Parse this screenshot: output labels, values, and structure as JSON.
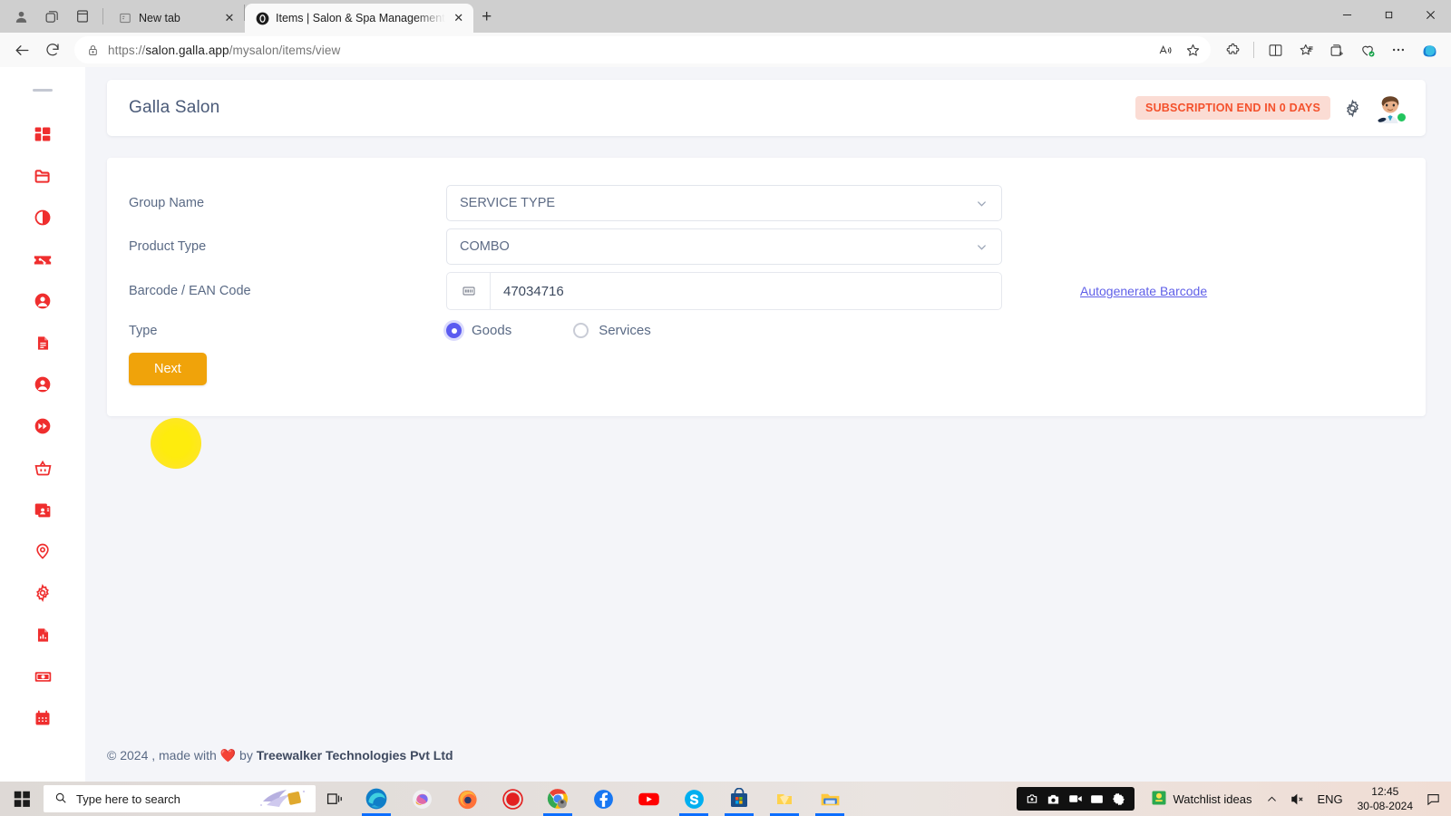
{
  "browser": {
    "tabs": [
      {
        "title": "New tab",
        "active": false,
        "favicon": "newtab-icon"
      },
      {
        "title": "Items | Salon & Spa Management",
        "active": true,
        "favicon": "site-favicon"
      }
    ],
    "newtab_label": "+",
    "close_label": "✕",
    "toolbar_icons": [
      "profile-icon",
      "workspaces-icon",
      "tab-actions-icon"
    ],
    "window_controls": {
      "minimize": "—",
      "maximize": "❐",
      "close": "✕"
    },
    "address": {
      "url_prefix": "https://",
      "url_host": "salon.galla.app",
      "url_path": "/mysalon/items/view",
      "full_url": "https://salon.galla.app/mysalon/items/view",
      "lock_icon": "lock-icon"
    },
    "nav": {
      "back": "back-arrow-icon",
      "refresh": "refresh-icon"
    },
    "omnibox_actions": [
      "read-aloud-icon",
      "favorite-star-icon"
    ],
    "toolbar_right": [
      "extensions-icon",
      "split-screen-icon",
      "collections-icon",
      "add-collection-icon",
      "browser-essentials-icon",
      "settings-more-icon",
      "copilot-icon"
    ]
  },
  "sidebar": {
    "collapse_handle": "collapse-handle",
    "items": [
      {
        "icon": "dashboard-grid-icon",
        "name": "dashboard"
      },
      {
        "icon": "folder-icon",
        "name": "catalog"
      },
      {
        "icon": "contrast-circle-icon",
        "name": "appearance"
      },
      {
        "icon": "discount-tag-icon",
        "name": "offers"
      },
      {
        "icon": "user-circle-icon",
        "name": "customers"
      },
      {
        "icon": "document-icon",
        "name": "invoices"
      },
      {
        "icon": "user-circle-icon",
        "name": "staff"
      },
      {
        "icon": "fast-forward-icon",
        "name": "quick-actions"
      },
      {
        "icon": "basket-icon",
        "name": "orders"
      },
      {
        "icon": "id-card-icon",
        "name": "memberships"
      },
      {
        "icon": "location-pin-icon",
        "name": "branches"
      },
      {
        "icon": "gear-icon",
        "name": "settings"
      },
      {
        "icon": "report-chart-icon",
        "name": "reports"
      },
      {
        "icon": "money-icon",
        "name": "payments"
      },
      {
        "icon": "calendar-icon",
        "name": "appointments"
      }
    ]
  },
  "header": {
    "brand": "Galla Salon",
    "subscription_badge": "SUBSCRIPTION END IN 0 DAYS",
    "gear_icon": "gear-icon",
    "avatar": "user-avatar",
    "status": "online"
  },
  "form": {
    "fields": [
      {
        "label": "Group Name",
        "value": "SERVICE TYPE",
        "type": "select"
      },
      {
        "label": "Product Type",
        "value": "COMBO",
        "type": "select"
      }
    ],
    "barcode": {
      "label": "Barcode / EAN Code",
      "value": "47034716",
      "addon_icon": "barcode-icon",
      "link": "Autogenerate Barcode"
    },
    "type": {
      "label": "Type",
      "options": [
        {
          "label": "Goods",
          "selected": true
        },
        {
          "label": "Services",
          "selected": false
        }
      ]
    },
    "next_button": "Next"
  },
  "footer": {
    "copyright": "© 2024 , made with",
    "heart": "❤️",
    "by": "by",
    "company": "Treewalker Technologies Pvt Ltd"
  },
  "taskbar": {
    "start_icon": "windows-start-icon",
    "search_placeholder": "Type here to search",
    "search_icon": "search-icon",
    "taskview_icon": "task-view-icon",
    "apps": [
      {
        "name": "edge-icon",
        "running": true
      },
      {
        "name": "copilot-icon",
        "running": false
      },
      {
        "name": "firefox-icon",
        "running": false
      },
      {
        "name": "record-icon",
        "running": false
      },
      {
        "name": "chrome-icon",
        "running": true
      },
      {
        "name": "facebook-icon",
        "running": false
      },
      {
        "name": "youtube-icon",
        "running": false
      },
      {
        "name": "skype-icon",
        "running": true
      },
      {
        "name": "microsoft-store-icon",
        "running": true
      },
      {
        "name": "folder-yellow-icon",
        "running": true
      },
      {
        "name": "file-explorer-icon",
        "running": true
      }
    ],
    "recorder": [
      "screenshot-icon",
      "camera-icon",
      "video-icon",
      "screen-icon",
      "gear-icon"
    ],
    "tray_app_label": "Watchlist ideas",
    "tray_app_icon": "watchlist-icon",
    "chevron_icon": "chevron-up-icon",
    "volume_icon": "volume-muted-icon",
    "language": "ENG",
    "time": "12:45",
    "date": "30-08-2024",
    "notification_icon": "notification-icon"
  }
}
